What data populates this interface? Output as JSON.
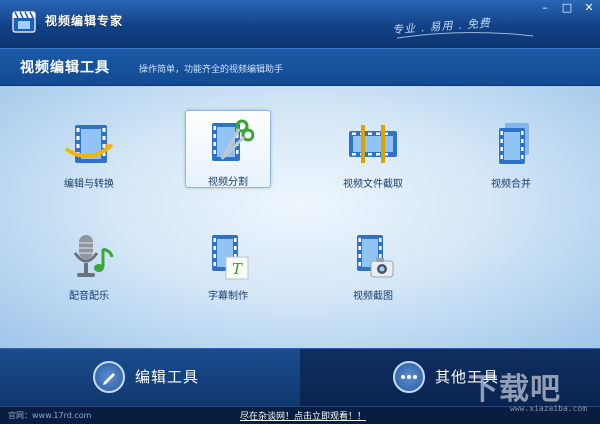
{
  "app": {
    "title": "视频编辑专家",
    "slogan": "专业 . 易用 . 免费"
  },
  "window_controls": {
    "minimize": "–",
    "maximize": "□",
    "close": "✕"
  },
  "header": {
    "title": "视频编辑工具",
    "subtitle": "操作简单，功能齐全的视频编辑助手"
  },
  "tools": [
    {
      "label": "编辑与转换",
      "icon": "film-convert-icon",
      "selected": false
    },
    {
      "label": "视频分割",
      "icon": "film-scissors-icon",
      "selected": true
    },
    {
      "label": "视频文件截取",
      "icon": "film-clip-icon",
      "selected": false
    },
    {
      "label": "视频合并",
      "icon": "film-merge-icon",
      "selected": false
    },
    {
      "label": "配音配乐",
      "icon": "microphone-music-icon",
      "selected": false
    },
    {
      "label": "字幕制作",
      "icon": "film-subtitle-icon",
      "selected": false
    },
    {
      "label": "视频截图",
      "icon": "film-camera-icon",
      "selected": false
    }
  ],
  "bottom_tabs": [
    {
      "label": "编辑工具",
      "icon": "pen-icon",
      "active": true
    },
    {
      "label": "其他工具",
      "icon": "more-dots-icon",
      "active": false
    }
  ],
  "footer": {
    "site": "官网：www.17rd.com",
    "promo": "尽在杂谈网！点击立即观看！！",
    "watermark": "下载吧",
    "watermark_sub": "www.xiazaiba.com"
  },
  "colors": {
    "titlebar": "#114187",
    "content_bg": "#d4e7f7",
    "film_blue": "#2f73c8",
    "bottom_active": "#1b4c8e"
  }
}
